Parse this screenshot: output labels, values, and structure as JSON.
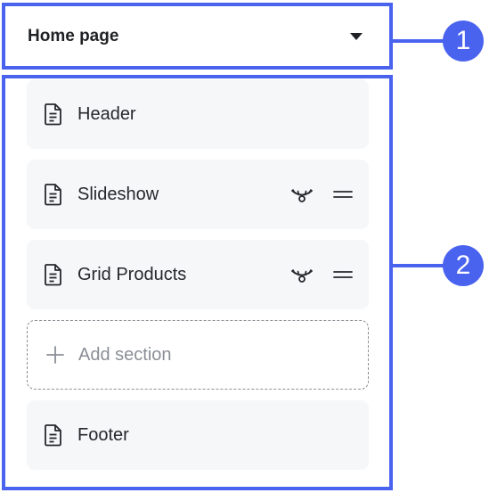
{
  "page_selector": {
    "label": "Home page"
  },
  "sections": [
    {
      "label": "Header",
      "show_actions": false
    },
    {
      "label": "Slideshow",
      "show_actions": true
    },
    {
      "label": "Grid Products",
      "show_actions": true
    },
    {
      "label": "Add section",
      "is_add": true
    },
    {
      "label": "Footer",
      "show_actions": false
    }
  ],
  "annotations": {
    "marker_1": "1",
    "marker_2": "2"
  },
  "colors": {
    "accent": "#4a63ef",
    "card_bg": "#f6f7f9",
    "text": "#25282b",
    "muted": "#8a8f96"
  },
  "icons": {
    "section": "document-icon",
    "visibility": "eye-closed-icon",
    "reorder": "drag-handle-icon",
    "add": "plus-icon",
    "dropdown": "caret-down-icon"
  }
}
